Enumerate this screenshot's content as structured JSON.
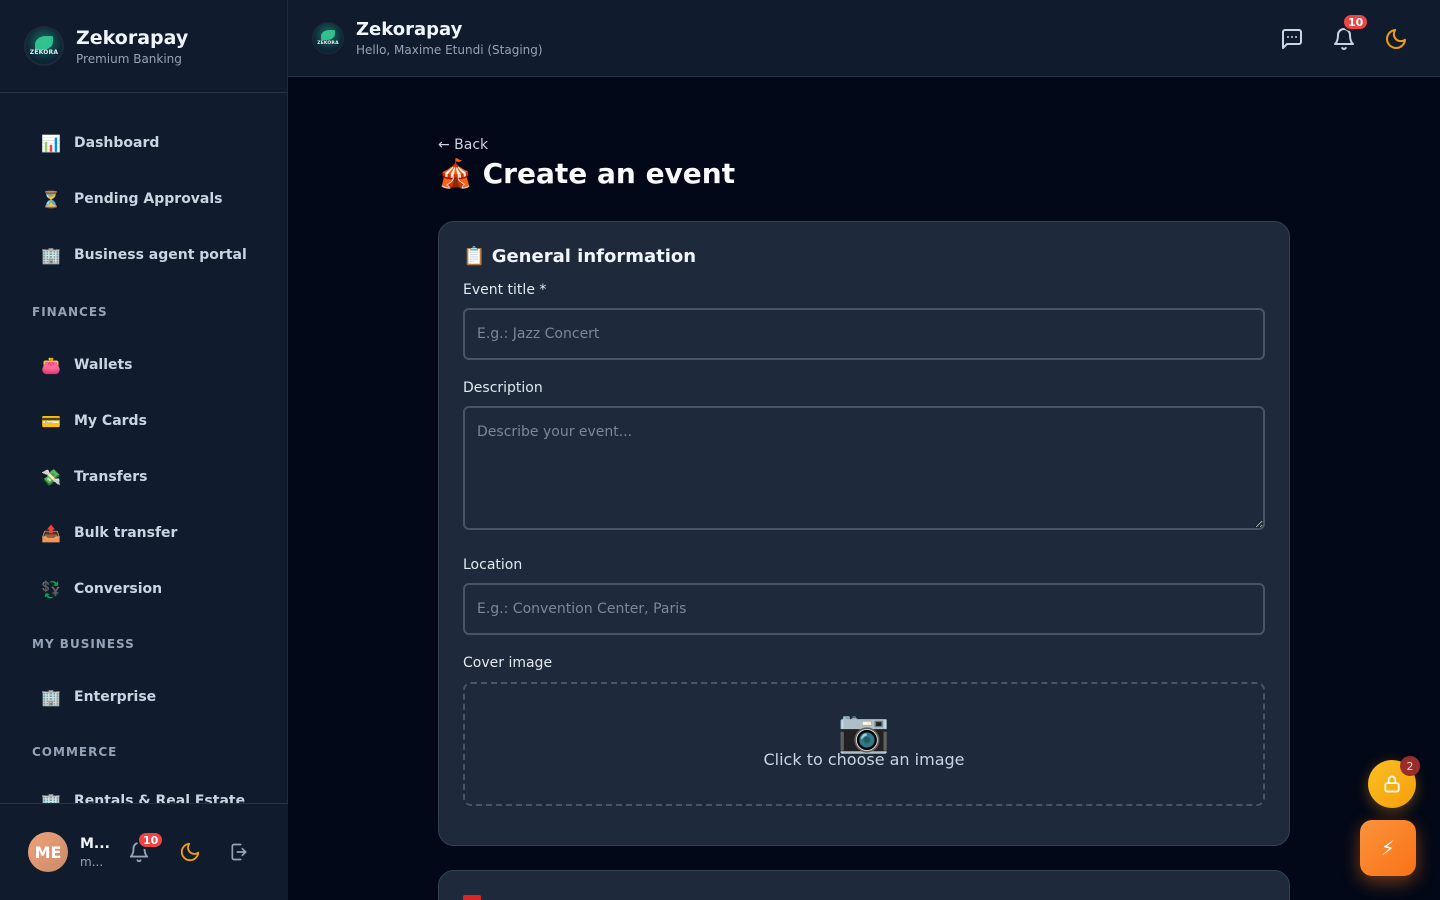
{
  "brand": {
    "logo_text": "ZEKORA",
    "name": "Zekorapay",
    "subtitle": "Premium Banking"
  },
  "sidebar": {
    "items": [
      {
        "icon": "📊",
        "label": "Dashboard"
      },
      {
        "icon": "⏳",
        "label": "Pending Approvals"
      },
      {
        "icon": "🏢",
        "label": "Business agent portal"
      }
    ],
    "sections": [
      {
        "title": "FINANCES",
        "items": [
          {
            "icon": "👛",
            "label": "Wallets"
          },
          {
            "icon": "💳",
            "label": "My Cards"
          },
          {
            "icon": "💸",
            "label": "Transfers"
          },
          {
            "icon": "📤",
            "label": "Bulk transfer"
          },
          {
            "icon": "💱",
            "label": "Conversion"
          }
        ]
      },
      {
        "title": "MY BUSINESS",
        "items": [
          {
            "icon": "🏢",
            "label": "Enterprise"
          }
        ]
      },
      {
        "title": "COMMERCE",
        "items": [
          {
            "icon": "🏢",
            "label": "Rentals & Real Estate"
          }
        ]
      }
    ]
  },
  "user": {
    "initials": "ME",
    "name": "M...",
    "email": "m...",
    "notification_count": "10"
  },
  "header": {
    "logo_text": "ZEKORA",
    "title": "Zekorapay",
    "subtitle": "Hello, Maxime Etundi (Staging)",
    "notification_count": "10"
  },
  "page": {
    "back_label": "← Back",
    "title_icon": "🎪",
    "title": "Create an event"
  },
  "form": {
    "section_icon": "📋",
    "section_title": "General information",
    "title_label": "Event title *",
    "title_placeholder": "E.g.: Jazz Concert",
    "description_label": "Description",
    "description_placeholder": "Describe your event...",
    "location_label": "Location",
    "location_placeholder": "E.g.: Convention Center, Paris",
    "cover_label": "Cover image",
    "cover_icon": "📷",
    "cover_text": "Click to choose an image"
  },
  "fab": {
    "lock_badge": "2",
    "bolt_icon": "⚡"
  },
  "colors": {
    "accent": "#f97316",
    "badge": "#ef4444",
    "background": "#020817",
    "panel": "#111b2e",
    "card": "#1e293b"
  }
}
